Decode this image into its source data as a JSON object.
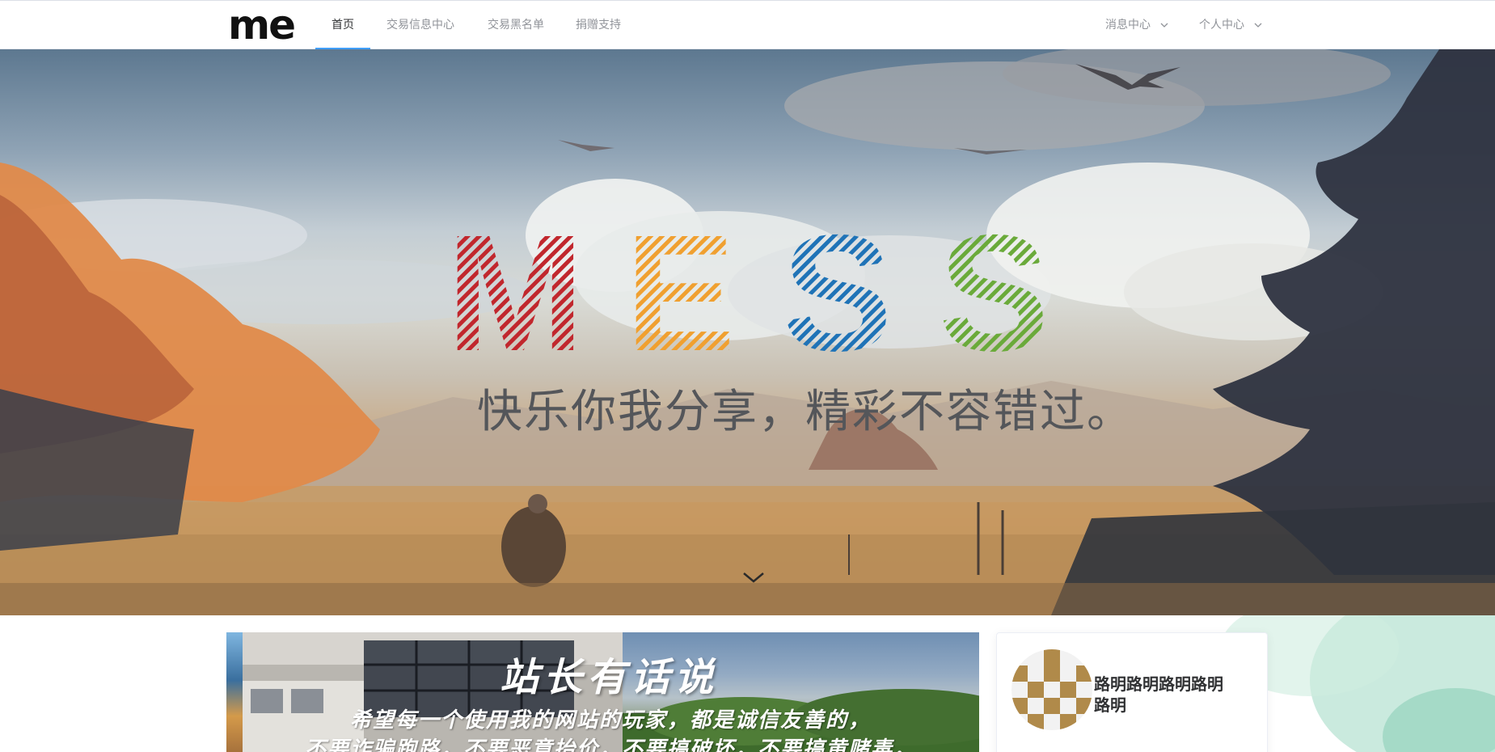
{
  "logo": {
    "text": "me"
  },
  "nav": {
    "items": [
      {
        "label": "首页",
        "active": true
      },
      {
        "label": "交易信息中心",
        "active": false
      },
      {
        "label": "交易黑名单",
        "active": false
      },
      {
        "label": "捐赠支持",
        "active": false
      }
    ],
    "right": [
      {
        "label": "消息中心",
        "icon": "chevron-down-icon"
      },
      {
        "label": "个人中心",
        "icon": "chevron-down-icon"
      }
    ]
  },
  "hero": {
    "title_letters": [
      {
        "char": "M",
        "color": "#c1272d"
      },
      {
        "char": "E",
        "color": "#f0a030"
      },
      {
        "char": "S",
        "color": "#1f73b7"
      },
      {
        "char": "S",
        "color": "#6aaa3a"
      }
    ],
    "slogan": "快乐你我分享，精彩不容错过。",
    "scroll_icon": "chevron-down-icon"
  },
  "banner": {
    "title": "站长有话说",
    "lines": [
      "希望每一个使用我的网站的玩家，都是诚信友善的，",
      "不要诈骗跑路，不要恶意抬价，不要搞破坏，不要搞黄赌毒，"
    ]
  },
  "profile": {
    "name": "路明路明路明路明路明",
    "avatar_icon": "checker-avatar-icon",
    "avatar_color": "#b08a4a"
  },
  "colors": {
    "nav_active_underline": "#409eff",
    "nav_text": "#909399",
    "nav_text_active": "#303133"
  }
}
